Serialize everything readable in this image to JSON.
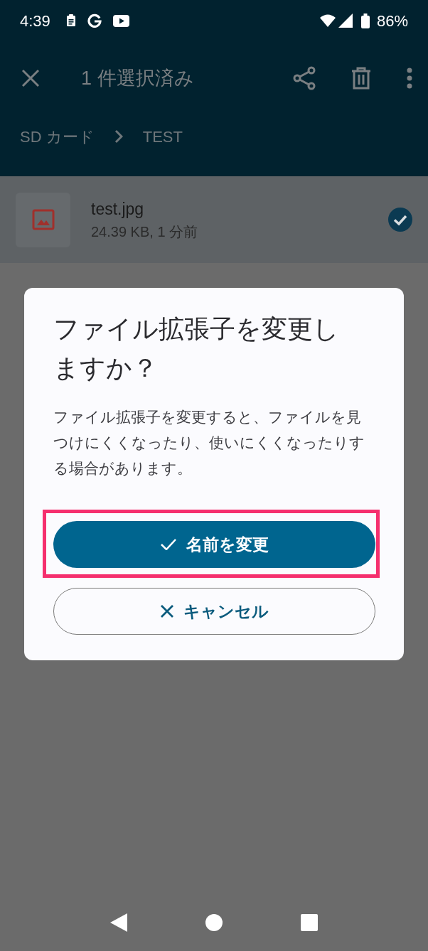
{
  "status_bar": {
    "time": "4:39",
    "battery": "86%"
  },
  "toolbar": {
    "title": "1 件選択済み"
  },
  "breadcrumb": [
    {
      "label": "SD カード"
    },
    {
      "label": "TEST"
    }
  ],
  "files": [
    {
      "name": "test.jpg",
      "details": "24.39 KB, 1 分前",
      "selected": true
    }
  ],
  "dialog": {
    "title": "ファイル拡張子を変更しますか？",
    "message": "ファイル拡張子を変更すると、ファイルを見つけにくくなったり、使いにくくなったりする場合があります。",
    "buttons": [
      {
        "label": "名前を変更",
        "kind": "filled",
        "highlighted": true
      },
      {
        "label": "キャンセル",
        "kind": "outlined",
        "highlighted": false
      }
    ]
  }
}
